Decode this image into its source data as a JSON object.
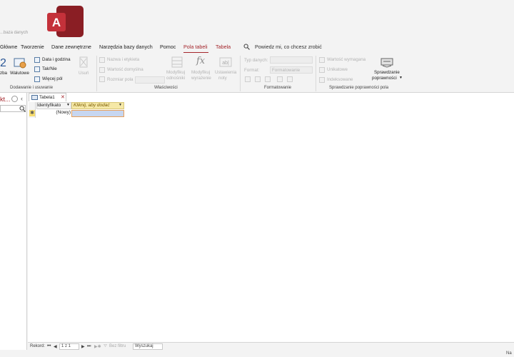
{
  "window": {
    "title": "...baza danych"
  },
  "menu": {
    "items": [
      "Główne",
      "Tworzenie",
      "Dane zewnętrzne",
      "Narzędzia bazy danych",
      "Pomoc",
      "Pola tabeli",
      "Tabela"
    ],
    "active_index": 5,
    "tell_me": "Powiedz mi, co chcesz zrobić"
  },
  "ribbon": {
    "add_delete": {
      "number_label": "2",
      "text_label": "zba",
      "currency_label": "Walutowe",
      "date_time_label": "Data i godzina",
      "yes_no_label": "Tak/Nie",
      "more_fields_label": "Więcej pól",
      "delete_label": "Usuń",
      "group_label": "Dodawanie i usuwanie"
    },
    "properties": {
      "name_caption": "Nazwa i etykieta",
      "default_value": "Wartość domyślna",
      "field_size": "Rozmiar pola",
      "modify_lookups_1": "Modyfikuj",
      "modify_lookups_2": "odnośniki",
      "modify_expression_1": "Modyfikuj",
      "modify_expression_2": "wyrażenie",
      "memo_settings_1": "Ustawienia",
      "memo_settings_2": "noty",
      "group_label": "Właściwości"
    },
    "formatting": {
      "data_type": "Typ danych:",
      "format": "Format:",
      "format_value": "Formatowanie",
      "group_label": "Formatowanie"
    },
    "validation": {
      "required": "Wartość wymagana",
      "unique": "Unikatowe",
      "indexed": "Indeksowane",
      "validation_button_1": "Sprawdzanie",
      "validation_button_2": "poprawności",
      "group_label": "Sprawdzanie poprawności pola"
    }
  },
  "nav_pane": {
    "title": "kt..."
  },
  "document": {
    "tab_label": "Tabela1",
    "columns": [
      "Identyfikato",
      "Kliknij, aby dodać"
    ],
    "new_row_label": "(Nowy)"
  },
  "statusbar": {
    "record_label": "Rekord:",
    "record_position": "1 z 1",
    "filter_label": "Bez filtru",
    "search_label": "Wyszukaj",
    "right_label": "Na"
  },
  "colors": {
    "accent": "#a4262c",
    "header_highlight": "#f5e8a7",
    "selection": "#c7d6f0"
  }
}
